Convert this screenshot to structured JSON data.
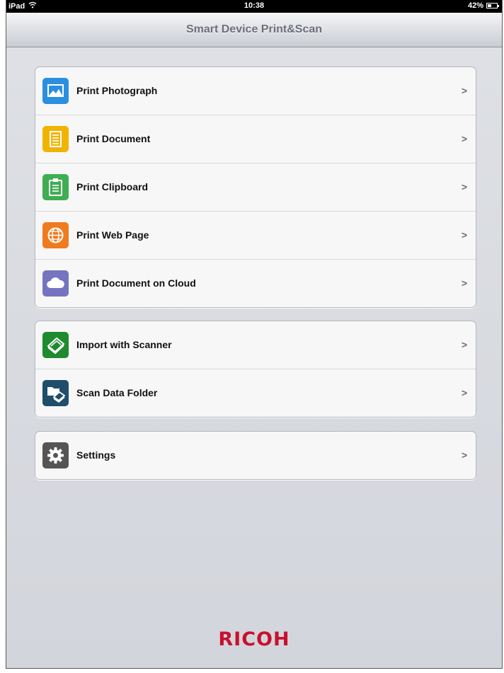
{
  "status": {
    "device": "iPad",
    "time": "10:38",
    "battery": "42%",
    "battery_level": 0.42
  },
  "navbar": {
    "title": "Smart Device Print&Scan"
  },
  "groups": [
    [
      {
        "label": "Print Photograph",
        "icon": "photo-icon",
        "color": "#2b8fe0"
      },
      {
        "label": "Print Document",
        "icon": "document-icon",
        "color": "#f0b400"
      },
      {
        "label": "Print Clipboard",
        "icon": "clipboard-icon",
        "color": "#3fae52"
      },
      {
        "label": "Print Web Page",
        "icon": "globe-icon",
        "color": "#f07a1e"
      },
      {
        "label": "Print Document on Cloud",
        "icon": "cloud-icon",
        "color": "#7674c0"
      }
    ],
    [
      {
        "label": "Import with Scanner",
        "icon": "scanner-icon",
        "color": "#1f8a2e"
      },
      {
        "label": "Scan Data Folder",
        "icon": "scan-folder-icon",
        "color": "#1f4e6a"
      }
    ],
    [
      {
        "label": "Settings",
        "icon": "gear-icon",
        "color": "#555555"
      }
    ]
  ],
  "chevron": ">",
  "brand": "RICOH"
}
